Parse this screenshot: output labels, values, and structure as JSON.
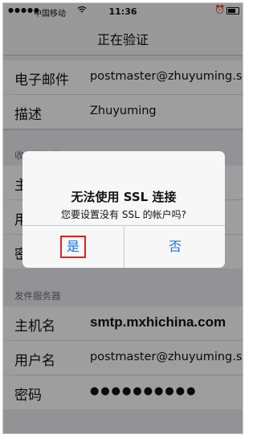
{
  "status_bar": {
    "signal": "●●●●●",
    "carrier": "中国移动",
    "time": "11:36"
  },
  "nav": {
    "title": "正在验证"
  },
  "account_rows": [
    {
      "label": "电子邮件",
      "value": "postmaster@zhuyuming.so"
    },
    {
      "label": "描述",
      "value": "Zhuyuming"
    }
  ],
  "incoming": {
    "header": "收件服务器",
    "rows": [
      {
        "label": "主",
        "value": ""
      },
      {
        "label": "用",
        "value": ""
      },
      {
        "label": "密",
        "value": ""
      }
    ]
  },
  "outgoing": {
    "header": "发件服务器",
    "rows": [
      {
        "label": "主机名",
        "value": "smtp.mxhichina.com"
      },
      {
        "label": "用户名",
        "value": "postmaster@zhuyuming.so"
      },
      {
        "label": "密码",
        "value": "●●●●●●●●●●"
      }
    ]
  },
  "alert": {
    "title": "无法使用 SSL 连接",
    "message": "您要设置没有 SSL 的帐户吗?",
    "yes_label": "是",
    "no_label": "否"
  },
  "colors": {
    "accent": "#1a73e8",
    "highlight_box": "#e02020",
    "background": "#eeeef1"
  }
}
